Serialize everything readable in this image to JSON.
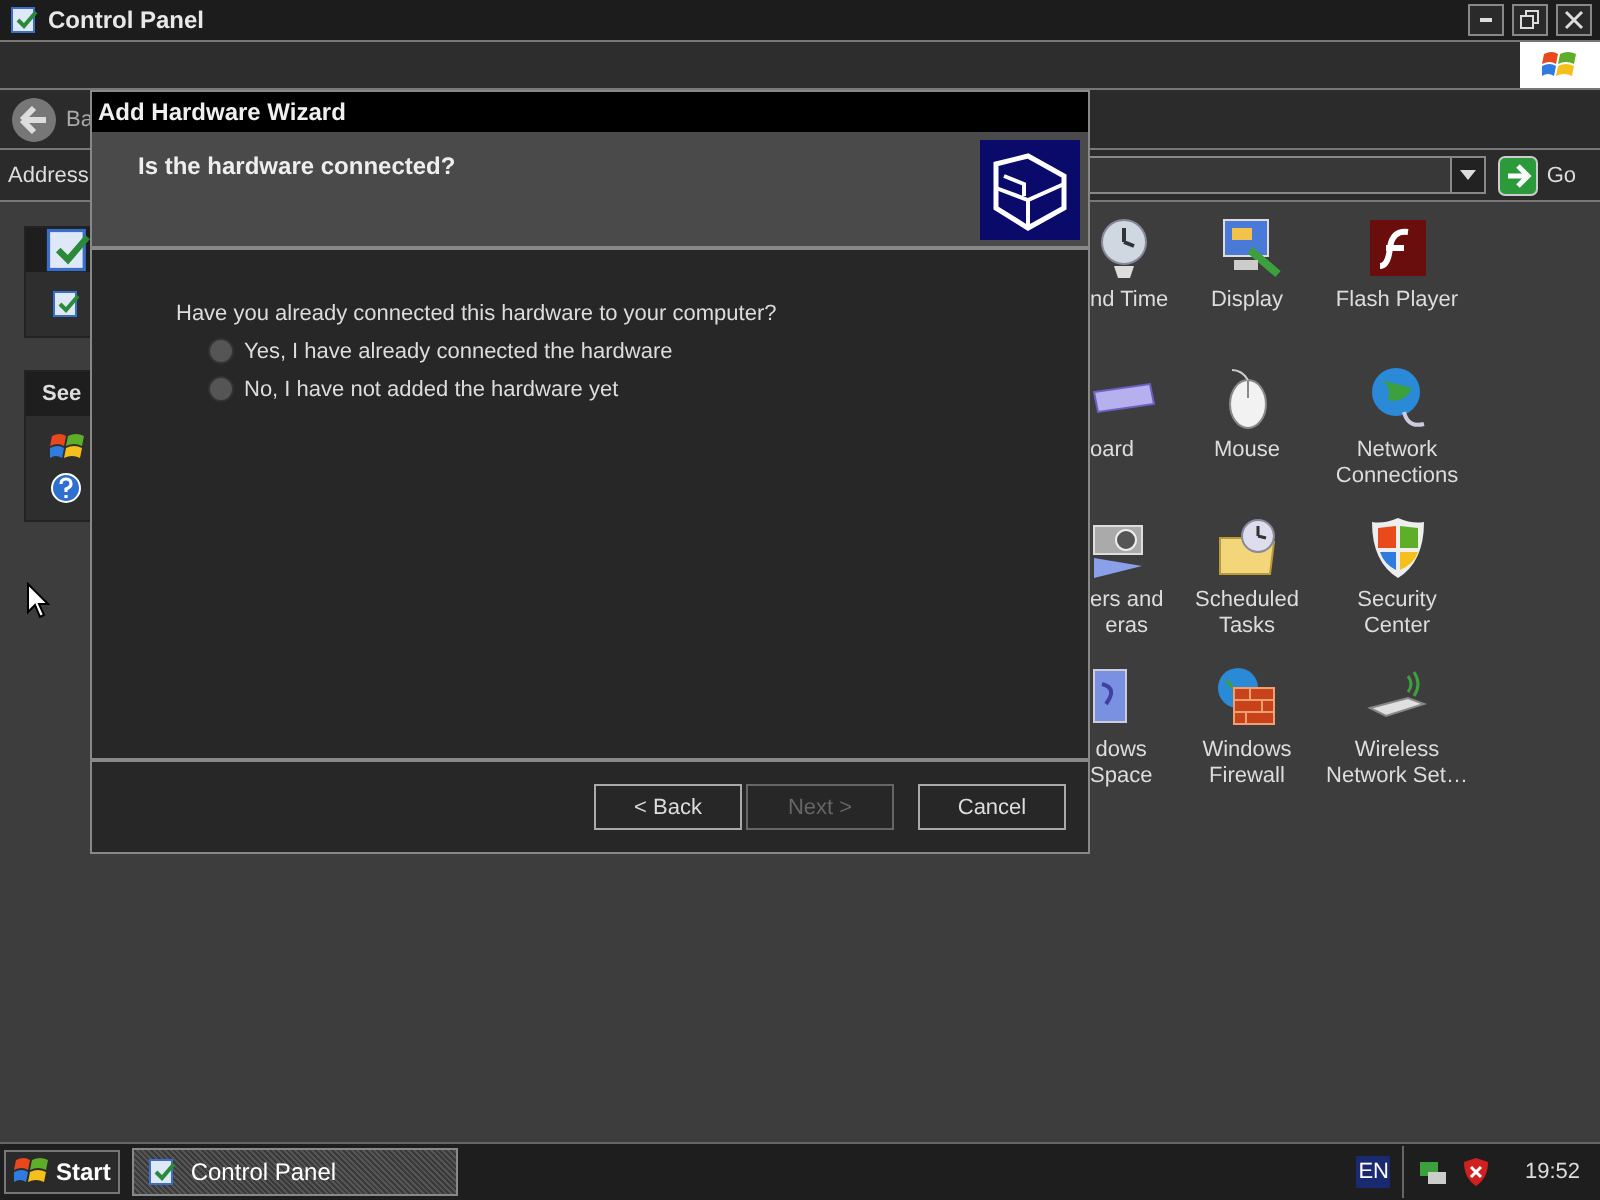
{
  "window": {
    "title": "Control Panel"
  },
  "toolbar": {
    "back_label": "Ba"
  },
  "address": {
    "label": "Address",
    "go": "Go"
  },
  "left_pane": {
    "section_title": "See"
  },
  "icons": [
    {
      "kind": "clock",
      "lines": [
        "nd Time"
      ]
    },
    {
      "kind": "display",
      "lines": [
        "Display"
      ]
    },
    {
      "kind": "flash",
      "lines": [
        "Flash Player"
      ]
    },
    {
      "kind": "keyboard",
      "lines": [
        "oard"
      ]
    },
    {
      "kind": "mouse",
      "lines": [
        "Mouse"
      ]
    },
    {
      "kind": "network",
      "lines": [
        "Network",
        "Connections"
      ]
    },
    {
      "kind": "camera",
      "lines": [
        "ers and",
        "eras"
      ]
    },
    {
      "kind": "tasks",
      "lines": [
        "Scheduled",
        "Tasks"
      ]
    },
    {
      "kind": "shield",
      "lines": [
        "Security",
        "Center"
      ]
    },
    {
      "kind": "space",
      "lines": [
        "dows",
        "Space"
      ]
    },
    {
      "kind": "firewall",
      "lines": [
        "Windows",
        "Firewall"
      ]
    },
    {
      "kind": "wireless",
      "lines": [
        "Wireless",
        "Network Set…"
      ]
    }
  ],
  "dialog": {
    "title": "Add Hardware Wizard",
    "header": "Is the hardware connected?",
    "question": "Have you already connected this hardware to your computer?",
    "options": [
      {
        "label": "Yes, I have already connected the hardware",
        "selected": false
      },
      {
        "label": "No, I have not added the hardware yet",
        "selected": false
      }
    ],
    "buttons": [
      {
        "label": "< Back",
        "disabled": false
      },
      {
        "label": "Next >",
        "disabled": true
      },
      {
        "label": "Cancel",
        "disabled": false
      }
    ]
  },
  "taskbar": {
    "start": "Start",
    "tasks": [
      {
        "label": "Control Panel",
        "selected": true
      }
    ],
    "language": "EN",
    "clock": "19:52"
  }
}
